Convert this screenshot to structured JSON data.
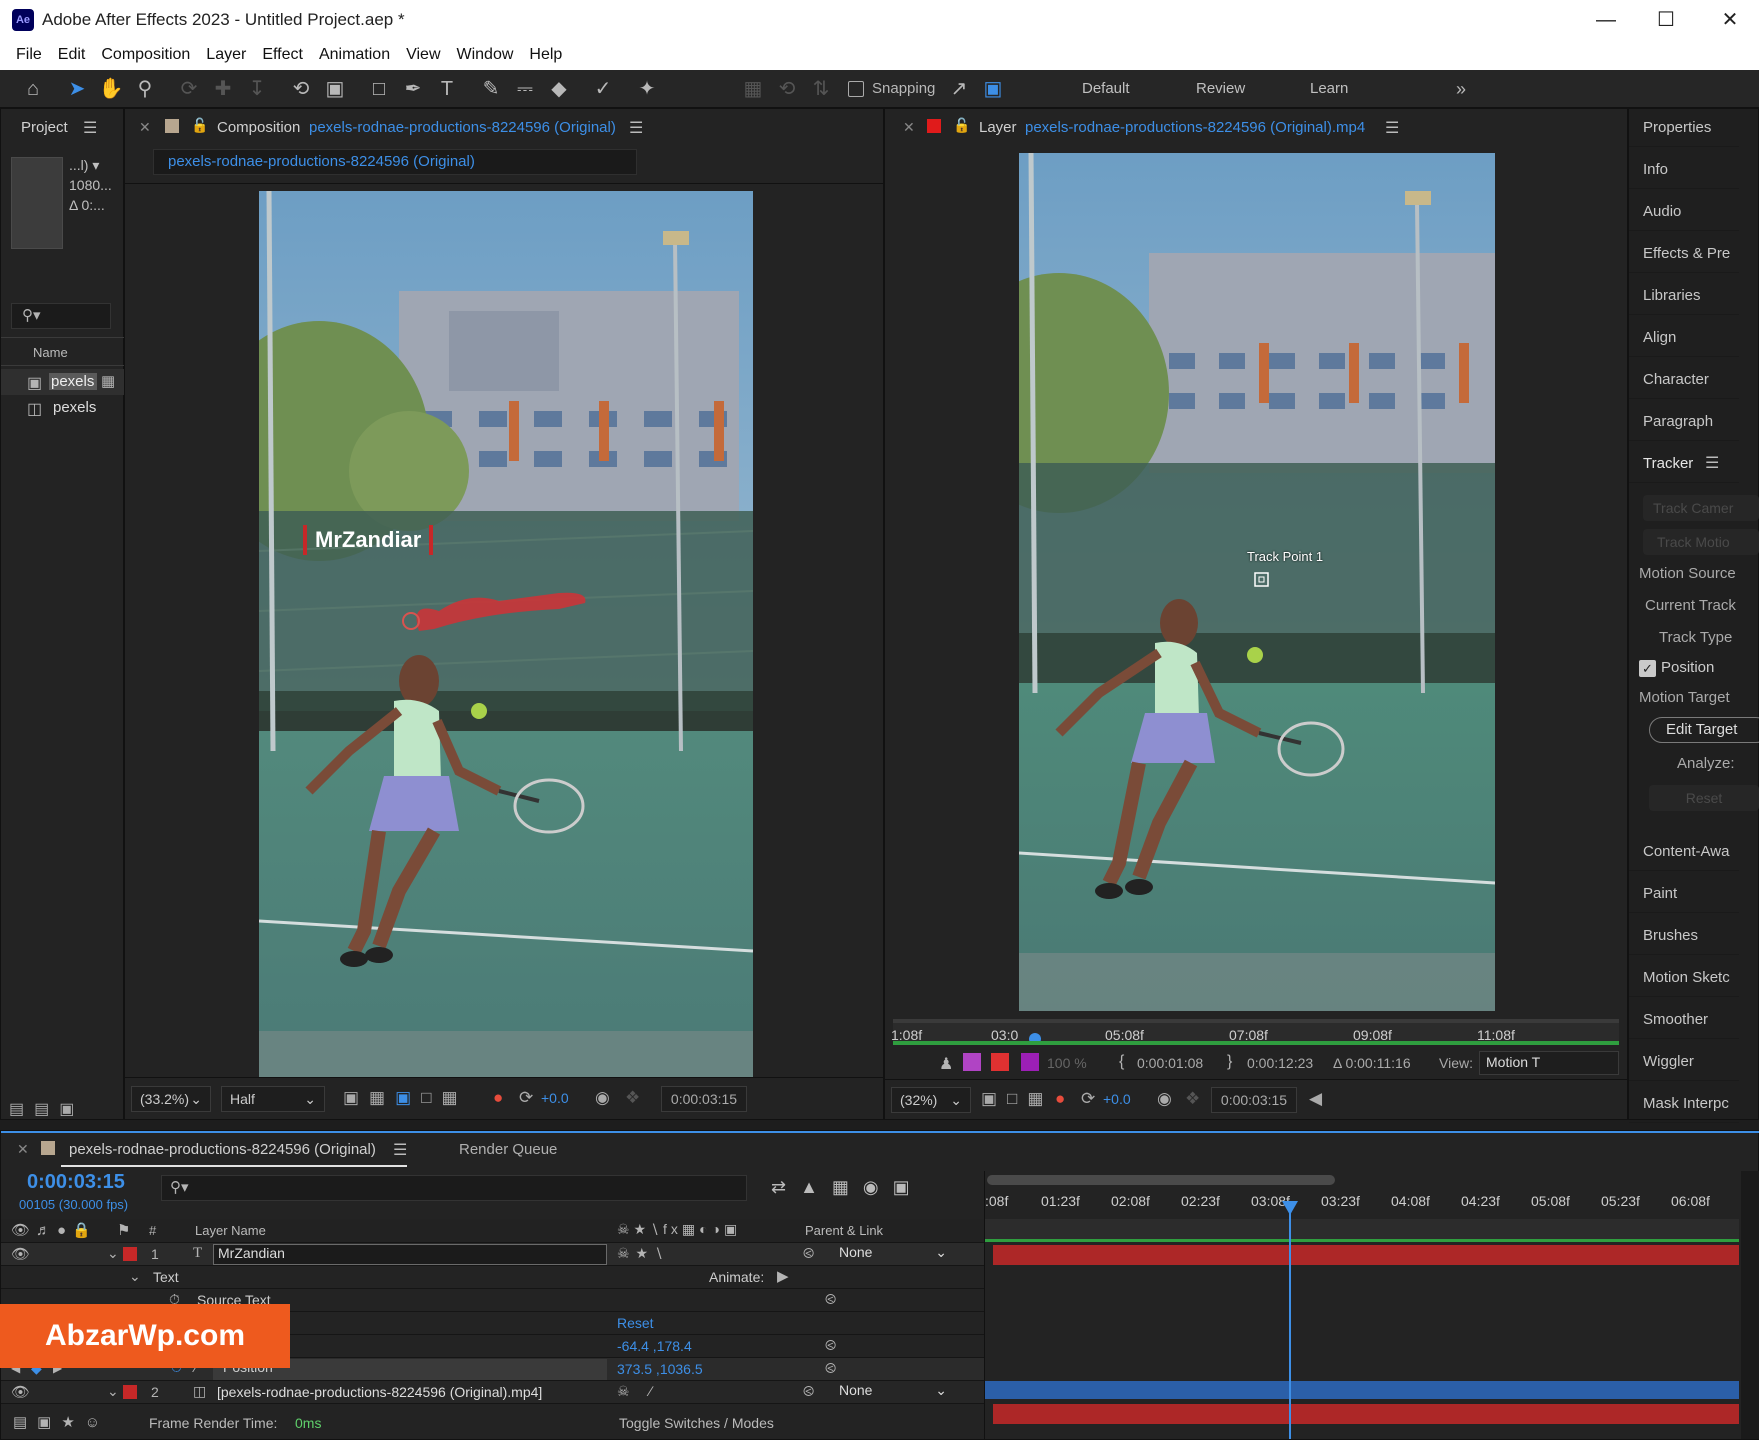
{
  "window": {
    "title": "Adobe After Effects 2023 - Untitled Project.aep *",
    "app_badge": "Ae",
    "min_icon": "minimize-icon",
    "max_icon": "maximize-icon",
    "close_icon": "close-icon"
  },
  "menu": [
    "File",
    "Edit",
    "Composition",
    "Layer",
    "Effect",
    "Animation",
    "View",
    "Window",
    "Help"
  ],
  "toolbar": {
    "snapping_label": "Snapping",
    "workspaces": [
      "Default",
      "Review",
      "Learn"
    ],
    "more_icon": "double-chevron-right-icon",
    "tools": [
      "home-icon",
      "selection-tool-icon",
      "hand-tool-icon",
      "zoom-tool-icon",
      "orbit-camera-icon",
      "pan-camera-icon",
      "dolly-camera-icon",
      "rotate-tool-icon",
      "pan-behind-icon",
      "rectangle-tool-icon",
      "pen-tool-icon",
      "type-tool-icon",
      "brush-tool-icon",
      "clone-stamp-icon",
      "eraser-tool-icon",
      "roto-brush-icon",
      "puppet-pin-icon"
    ]
  },
  "project_panel": {
    "title": "Project",
    "meta_lines": [
      "...l) ▾",
      "1080...",
      "Δ 0:..."
    ],
    "search_icon": "search-icon",
    "column_name": "Name",
    "items": [
      {
        "label": "pexels",
        "icon": "composition-icon"
      },
      {
        "label": "pexels",
        "icon": "footage-icon"
      }
    ]
  },
  "comp_panel": {
    "tab_prefix": "Composition",
    "tab_name": "pexels-rodnae-productions-8224596 (Original)",
    "breadcrumb": "pexels-rodnae-productions-8224596 (Original)",
    "overlay_text": "MrZandiar",
    "zoom": "(33.2%)",
    "resolution": "Half",
    "exposure": "+0.0",
    "timecode": "0:00:03:15"
  },
  "layer_panel": {
    "tab_prefix": "Layer",
    "tab_name": "pexels-rodnae-productions-8224596 (Original).mp4",
    "track_point_label": "Track Point 1",
    "ruler_ticks": [
      "1:08f",
      "03:0",
      "05:08f",
      "07:08f",
      "09:08f",
      "11:08f"
    ],
    "in_point": "0:00:01:08",
    "out_point": "0:00:12:23",
    "duration": "Δ 0:00:11:16",
    "view_label": "View:",
    "view_value": "Motion T",
    "opacity_value": "100 %",
    "zoom": "(32%)",
    "exposure": "+0.0",
    "timecode": "0:00:03:15"
  },
  "right_panel": {
    "items": [
      "Properties",
      "Info",
      "Audio",
      "Effects & Pre",
      "Libraries",
      "Align",
      "Character",
      "Paragraph"
    ],
    "tracker": {
      "title": "Tracker",
      "track_camera": "Track Camer",
      "track_motion": "Track Motio",
      "motion_source": "Motion Source",
      "current_track": "Current Track",
      "track_type": "Track Type",
      "position_label": "Position",
      "position_checked": true,
      "motion_target": "Motion Target",
      "edit_target": "Edit Target",
      "analyze": "Analyze:",
      "reset": "Reset"
    },
    "items2": [
      "Content-Awa",
      "Paint",
      "Brushes",
      "Motion Sketc",
      "Smoother",
      "Wiggler",
      "Mask Interpc"
    ]
  },
  "timeline": {
    "tab_name": "pexels-rodnae-productions-8224596 (Original)",
    "render_queue": "Render Queue",
    "timecode": "0:00:03:15",
    "frame_info": "00105 (30.000 fps)",
    "ruler_ticks": [
      ":08f",
      "01:23f",
      "02:08f",
      "02:23f",
      "03:08f",
      "03:23f",
      "04:08f",
      "04:23f",
      "05:08f",
      "05:23f",
      "06:08f"
    ],
    "col_hash": "#",
    "col_layer_name": "Layer Name",
    "col_parent": "Parent & Link",
    "rows": {
      "layer1_num": "1",
      "layer1_name": "MrZandian",
      "layer1_parent": "None",
      "text_group": "Text",
      "animate_label": "Animate:",
      "source_text": "Source Text",
      "reset_label": "Reset",
      "anchor_value": "-64.4 ,178.4",
      "position_label": "Position",
      "position_value": "373.5 ,1036.5",
      "layer2_num": "2",
      "layer2_name": "[pexels-rodnae-productions-8224596 (Original).mp4]",
      "layer2_parent": "None"
    },
    "frame_render_label": "Frame Render Time:",
    "frame_render_value": "0ms",
    "toggle_label": "Toggle Switches / Modes"
  },
  "watermark": "AbzarWp.com",
  "colors": {
    "accent": "#3d8fe7",
    "label_red": "#c62828",
    "watermark": "#ee5a1e"
  }
}
